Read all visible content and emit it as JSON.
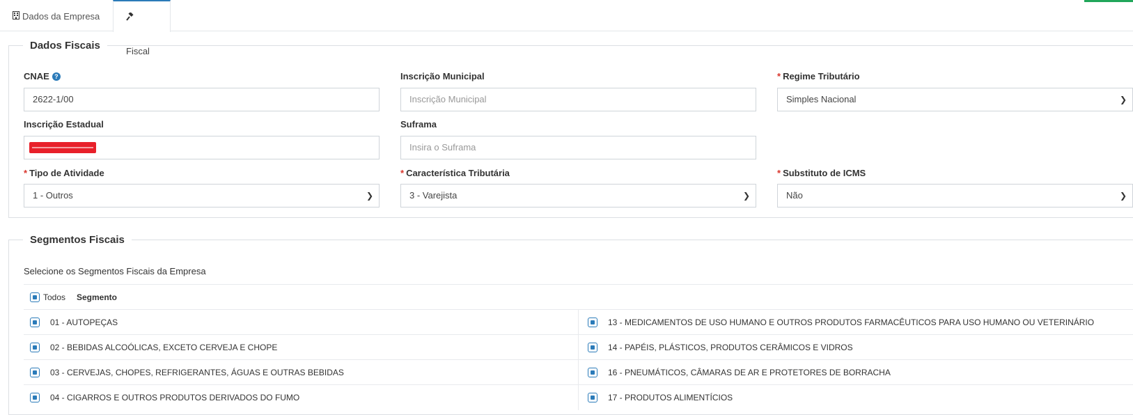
{
  "tabs": [
    {
      "label": "Dados da Empresa",
      "icon": "building-icon"
    },
    {
      "label": "Fiscal",
      "icon": "gavel-icon"
    }
  ],
  "accent_color": "#2b7bb9",
  "fiscal": {
    "legend": "Dados Fiscais",
    "cnae": {
      "label": "CNAE",
      "value": "2622-1/00"
    },
    "inscricao_municipal": {
      "label": "Inscrição Municipal",
      "placeholder": "Inscrição Municipal"
    },
    "regime": {
      "label": "Regime Tributário",
      "value": "Simples Nacional"
    },
    "inscricao_estadual": {
      "label": "Inscrição Estadual"
    },
    "suframa": {
      "label": "Suframa",
      "placeholder": "Insira o Suframa"
    },
    "tipo_atividade": {
      "label": "Tipo de Atividade",
      "value": "1 - Outros"
    },
    "caracteristica": {
      "label": "Característica Tributária",
      "value": "3 - Varejista"
    },
    "substituto": {
      "label": "Substituto de ICMS",
      "value": "Não"
    }
  },
  "segmentos": {
    "legend": "Segmentos Fiscais",
    "description": "Selecione os Segmentos Fiscais da Empresa",
    "all_label": "Todos",
    "column_header": "Segmento",
    "rows": [
      {
        "left": "01 - AUTOPEÇAS",
        "right": "13 - MEDICAMENTOS DE USO HUMANO E OUTROS PRODUTOS FARMACÊUTICOS PARA USO HUMANO OU VETERINÁRIO"
      },
      {
        "left": "02 - BEBIDAS ALCOÓLICAS, EXCETO CERVEJA E CHOPE",
        "right": "14 - PAPÉIS, PLÁSTICOS, PRODUTOS CERÂMICOS E VIDROS"
      },
      {
        "left": "03 - CERVEJAS, CHOPES, REFRIGERANTES, ÁGUAS E OUTRAS BEBIDAS",
        "right": "16 - PNEUMÁTICOS, CÂMARAS DE AR E PROTETORES DE BORRACHA"
      },
      {
        "left": "04 - CIGARROS E OUTROS PRODUTOS DERIVADOS DO FUMO",
        "right": "17 - PRODUTOS ALIMENTÍCIOS"
      }
    ]
  }
}
